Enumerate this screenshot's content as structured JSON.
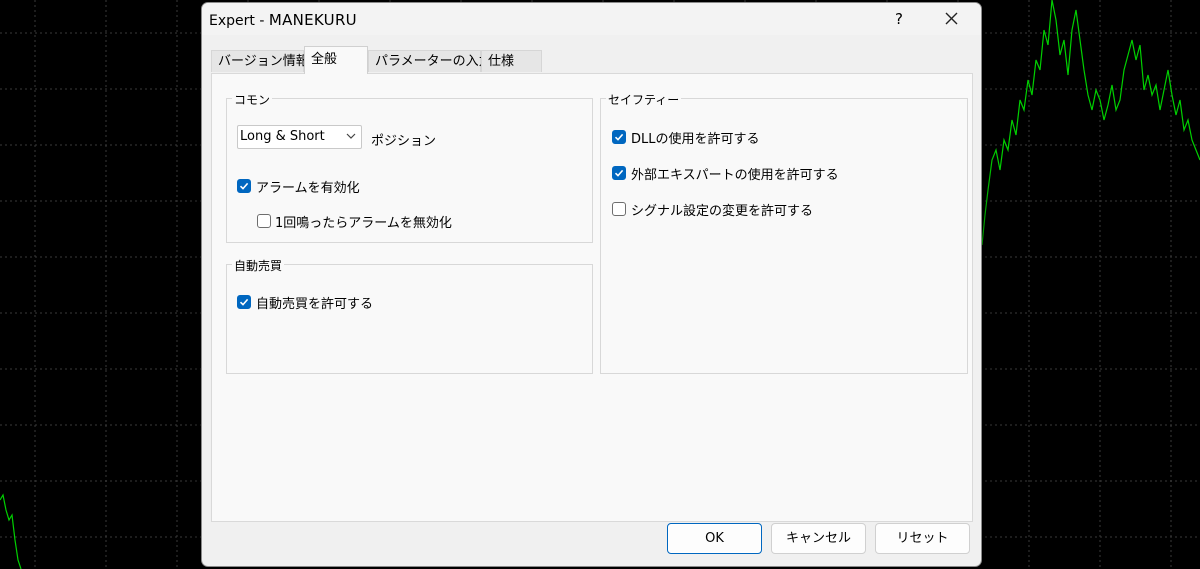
{
  "dialog": {
    "title_prefix": "Expert - ",
    "title_app": "MANEKURU",
    "help": "?"
  },
  "tabs": [
    {
      "label": "バージョン情報"
    },
    {
      "label": "全般"
    },
    {
      "label": "パラメーターの入力"
    },
    {
      "label": "仕様"
    }
  ],
  "common": {
    "label": "コモン",
    "position_value": "Long & Short",
    "position_label": "ポジション",
    "alarm_label": "アラームを有効化",
    "alarm_checked": true,
    "alarm_once_label": "1回鳴ったらアラームを無効化",
    "alarm_once_checked": false
  },
  "auto_trade": {
    "label": "自動売買",
    "allow_label": "自動売買を許可する",
    "allow_checked": true
  },
  "safety": {
    "label": "セイフティー",
    "items": [
      {
        "label": "DLLの使用を許可する",
        "checked": true
      },
      {
        "label": "外部エキスパートの使用を許可する",
        "checked": true
      },
      {
        "label": "シグナル設定の変更を許可する",
        "checked": false
      }
    ]
  },
  "buttons": {
    "ok": "OK",
    "cancel": "キャンセル",
    "reset": "リセット"
  },
  "colors": {
    "accent": "#0067c0",
    "chart_line": "#00d000",
    "chart_bg": "#000000",
    "grid": "#3a3a3a"
  }
}
